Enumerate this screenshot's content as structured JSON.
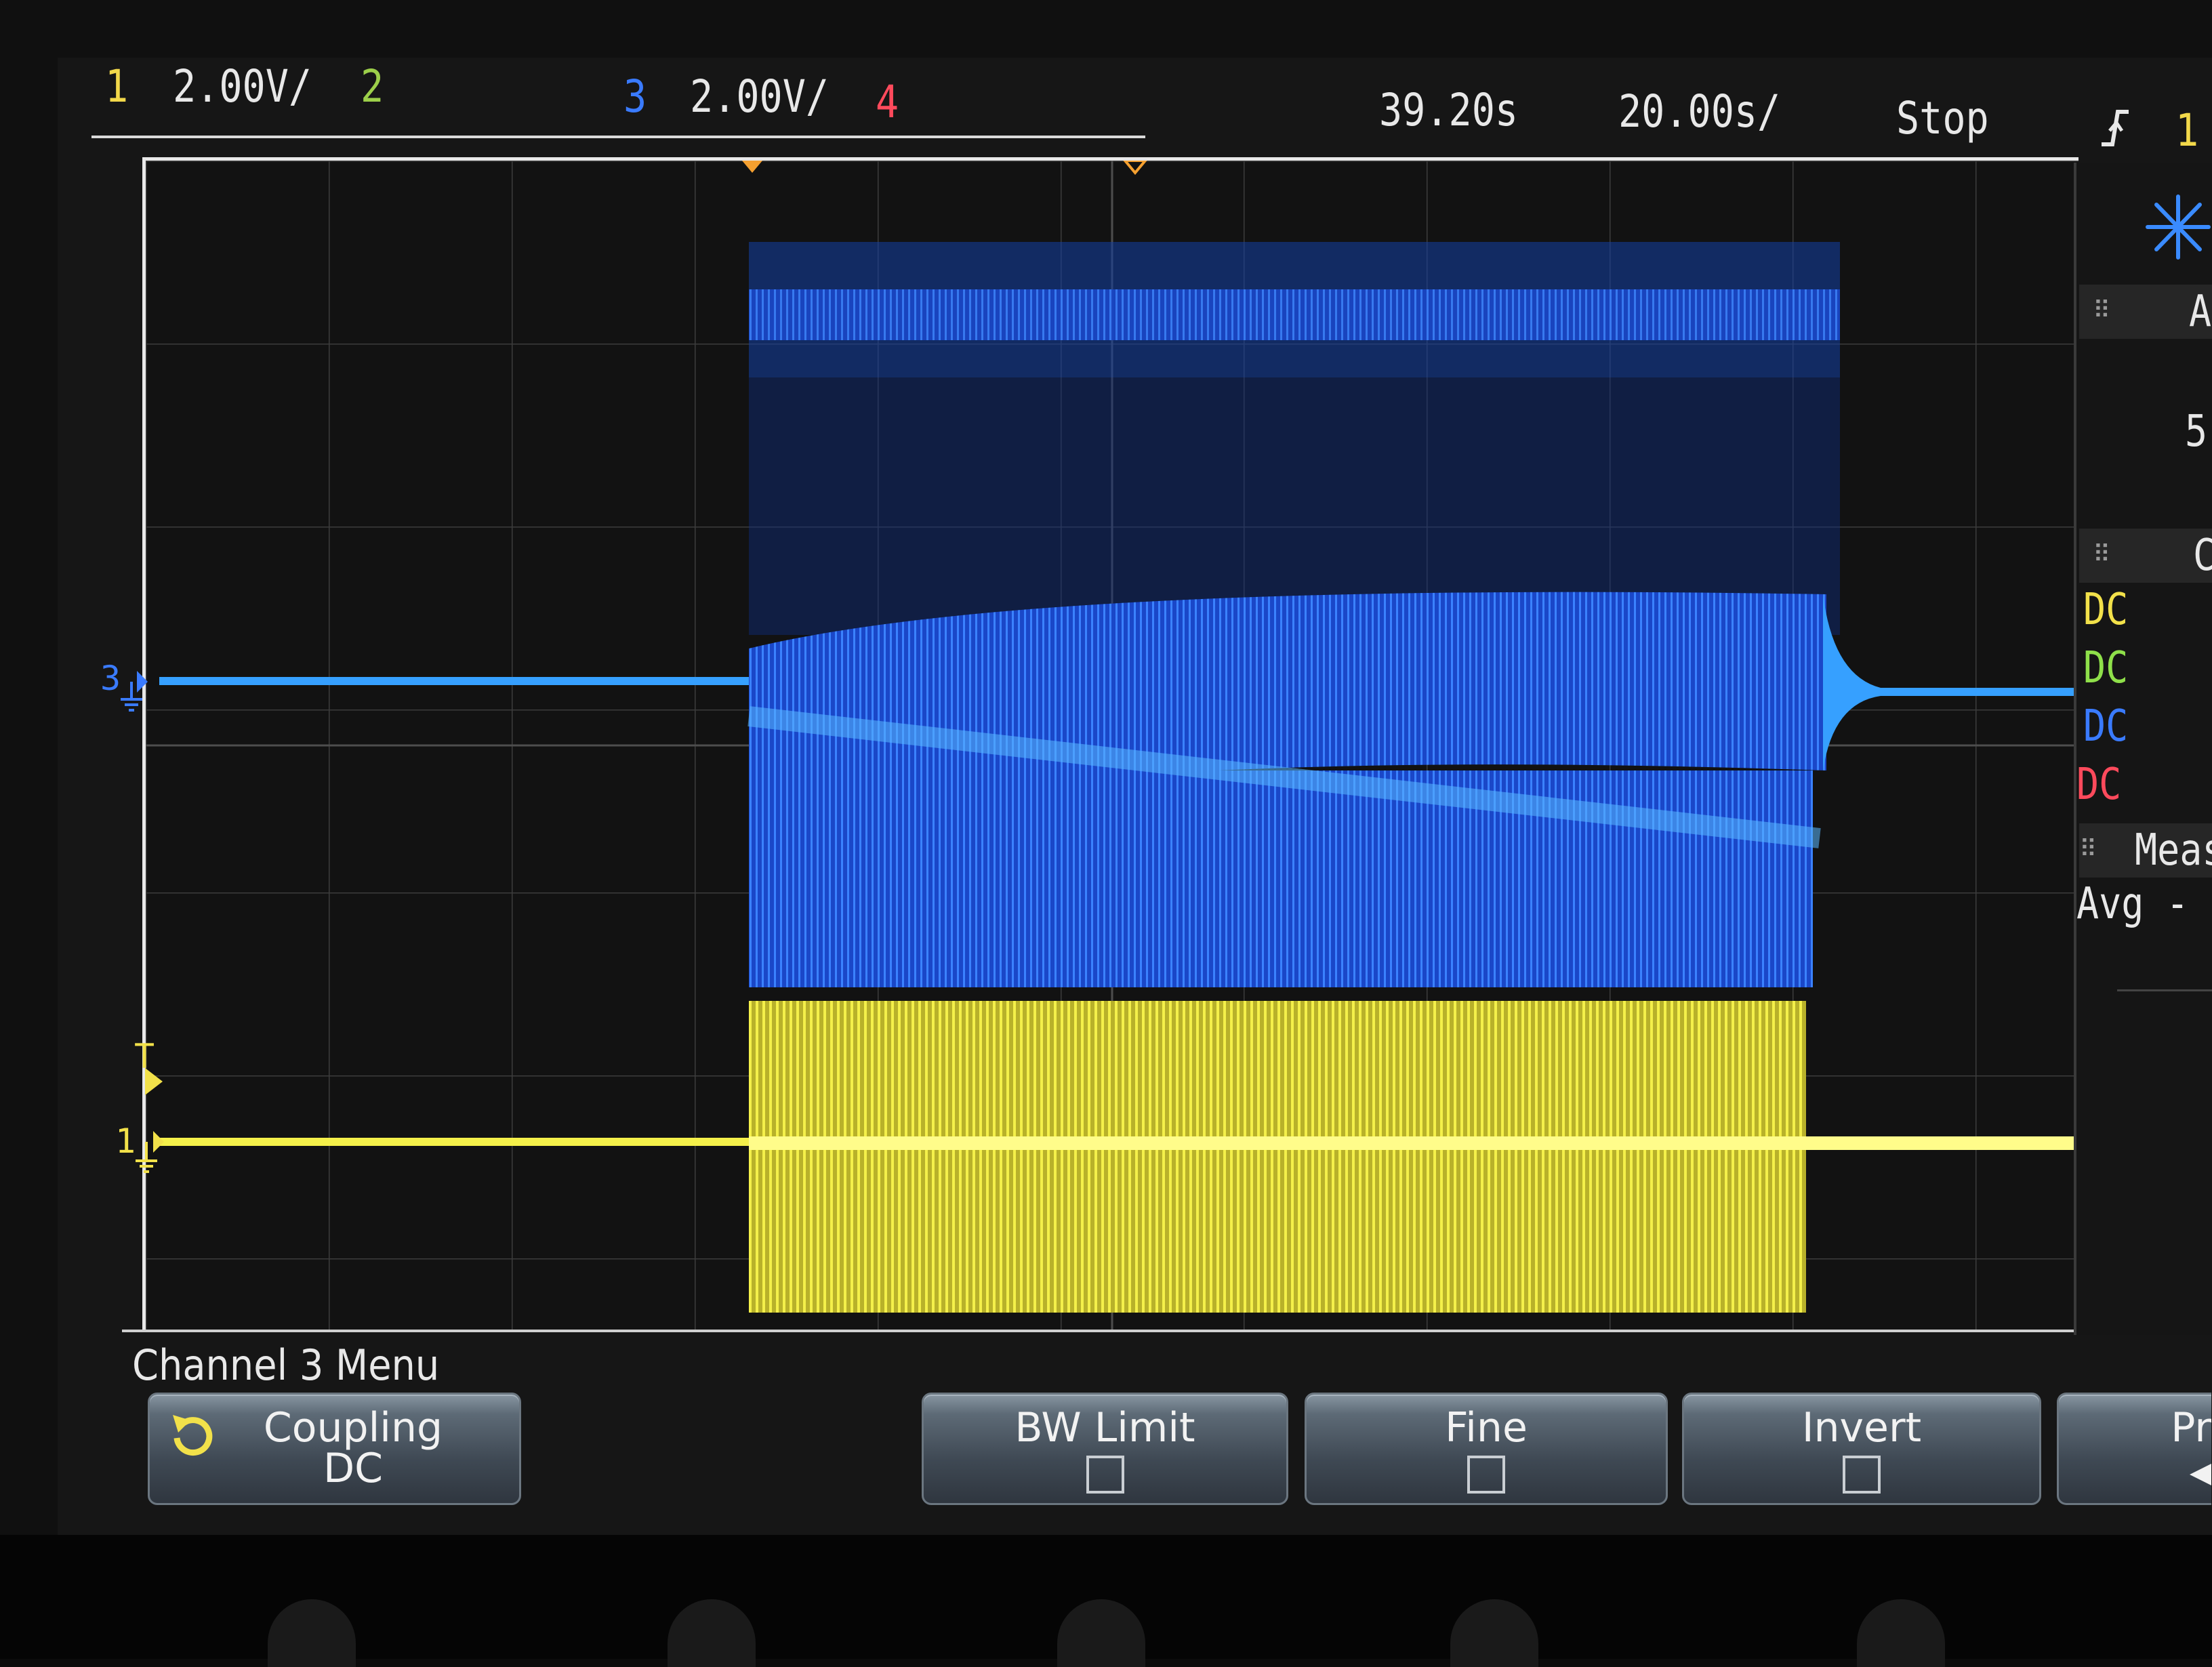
{
  "status_bar": {
    "ch1_number": "1",
    "ch1_scale": "2.00V/",
    "ch2_number": "2",
    "ch3_number": "3",
    "ch3_scale": "2.00V/",
    "ch4_number": "4",
    "time_delay": "39.20s",
    "time_scale": "20.00s/",
    "run_state": "Stop",
    "trigger_source": "1"
  },
  "trace_markers": {
    "ch3_ground": "3",
    "trigger_level": "T",
    "ch1_ground": "1"
  },
  "sidebar": {
    "section1_label": "A",
    "section1_value": "5",
    "section2_label": "C",
    "coupling_rows": [
      {
        "label": "DC",
        "color": "#f2e14a"
      },
      {
        "label": "DC",
        "color": "#8fe04a"
      },
      {
        "label": "DC",
        "color": "#3a7bff"
      },
      {
        "label": "DC",
        "color": "#ff4a5c"
      }
    ],
    "meas_header": "Meas",
    "meas_row": "Avg - FS"
  },
  "menu": {
    "title": "Channel 3 Menu",
    "softkeys": [
      {
        "label": "Coupling",
        "value": "DC",
        "icon": "rotate-knob-icon"
      },
      {
        "label": "BW Limit",
        "checked": false
      },
      {
        "label": "Fine",
        "checked": false
      },
      {
        "label": "Invert",
        "checked": false
      },
      {
        "label": "Pr"
      }
    ]
  },
  "colors": {
    "channel1": "#f4f04a",
    "channel2": "#8fe04a",
    "channel3": "#2f7bff",
    "channel4": "#ff4a5c",
    "grid": "#4a4a4a",
    "frame": "#e8e8e8"
  },
  "icons": {
    "trigger": "trigger-rising-edge-icon",
    "logo": "agilent-spark-icon",
    "grip": "grip-dots-icon"
  }
}
